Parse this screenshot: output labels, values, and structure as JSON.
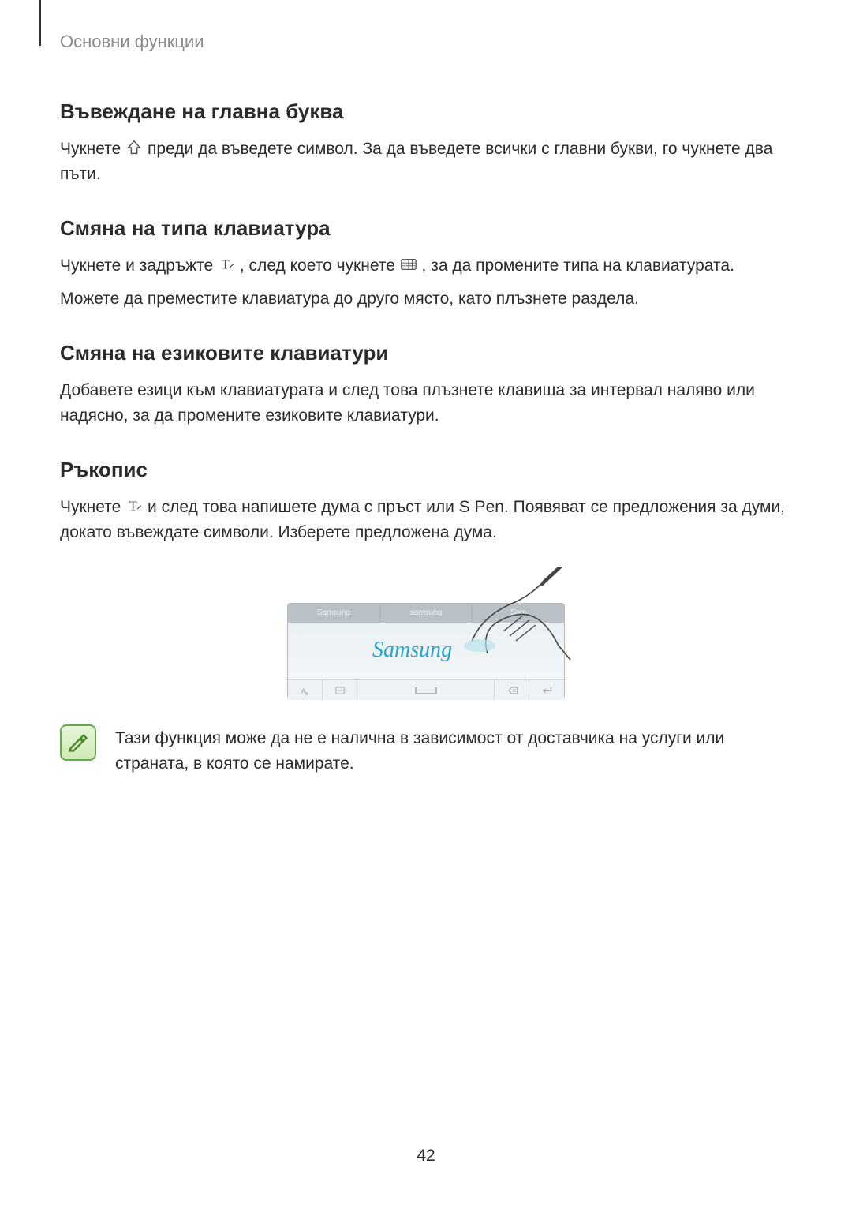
{
  "header": {
    "breadcrumb": "Основни функции"
  },
  "sections": {
    "caps": {
      "heading": "Въвеждане на главна буква",
      "p1a": "Чукнете ",
      "p1b": " преди да въведете символ. За да въведете всички с главни букви, го чукнете два пъти."
    },
    "kbtype": {
      "heading": "Смяна на типа клавиатура",
      "p1a": "Чукнете и задръжте ",
      "p1b": ", след което чукнете ",
      "p1c": ", за да промените типа на клавиатурата.",
      "p2": "Можете да преместите клавиатура до друго място, като плъзнете раздела."
    },
    "lang": {
      "heading": "Смяна на езиковите клавиатури",
      "p1": "Добавете езици към клавиатурата и след това плъзнете клавиша за интервал наляво или надясно, за да промените езиковите клавиатури."
    },
    "hand": {
      "heading": "Ръкопис",
      "p1a": "Чукнете ",
      "p1b": " и след това напишете дума с пръст или S Pen. Появяват се предложения за думи, докато въвеждате символи. Изберете предложена дума."
    }
  },
  "figure": {
    "suggestions": [
      "Samsung",
      "samsung",
      "Sam"
    ],
    "writing": "Samsung"
  },
  "note": {
    "text": "Тази функция може да не е налична в зависимост от доставчика на услуги или страната, в която се намирате."
  },
  "pageNumber": "42"
}
